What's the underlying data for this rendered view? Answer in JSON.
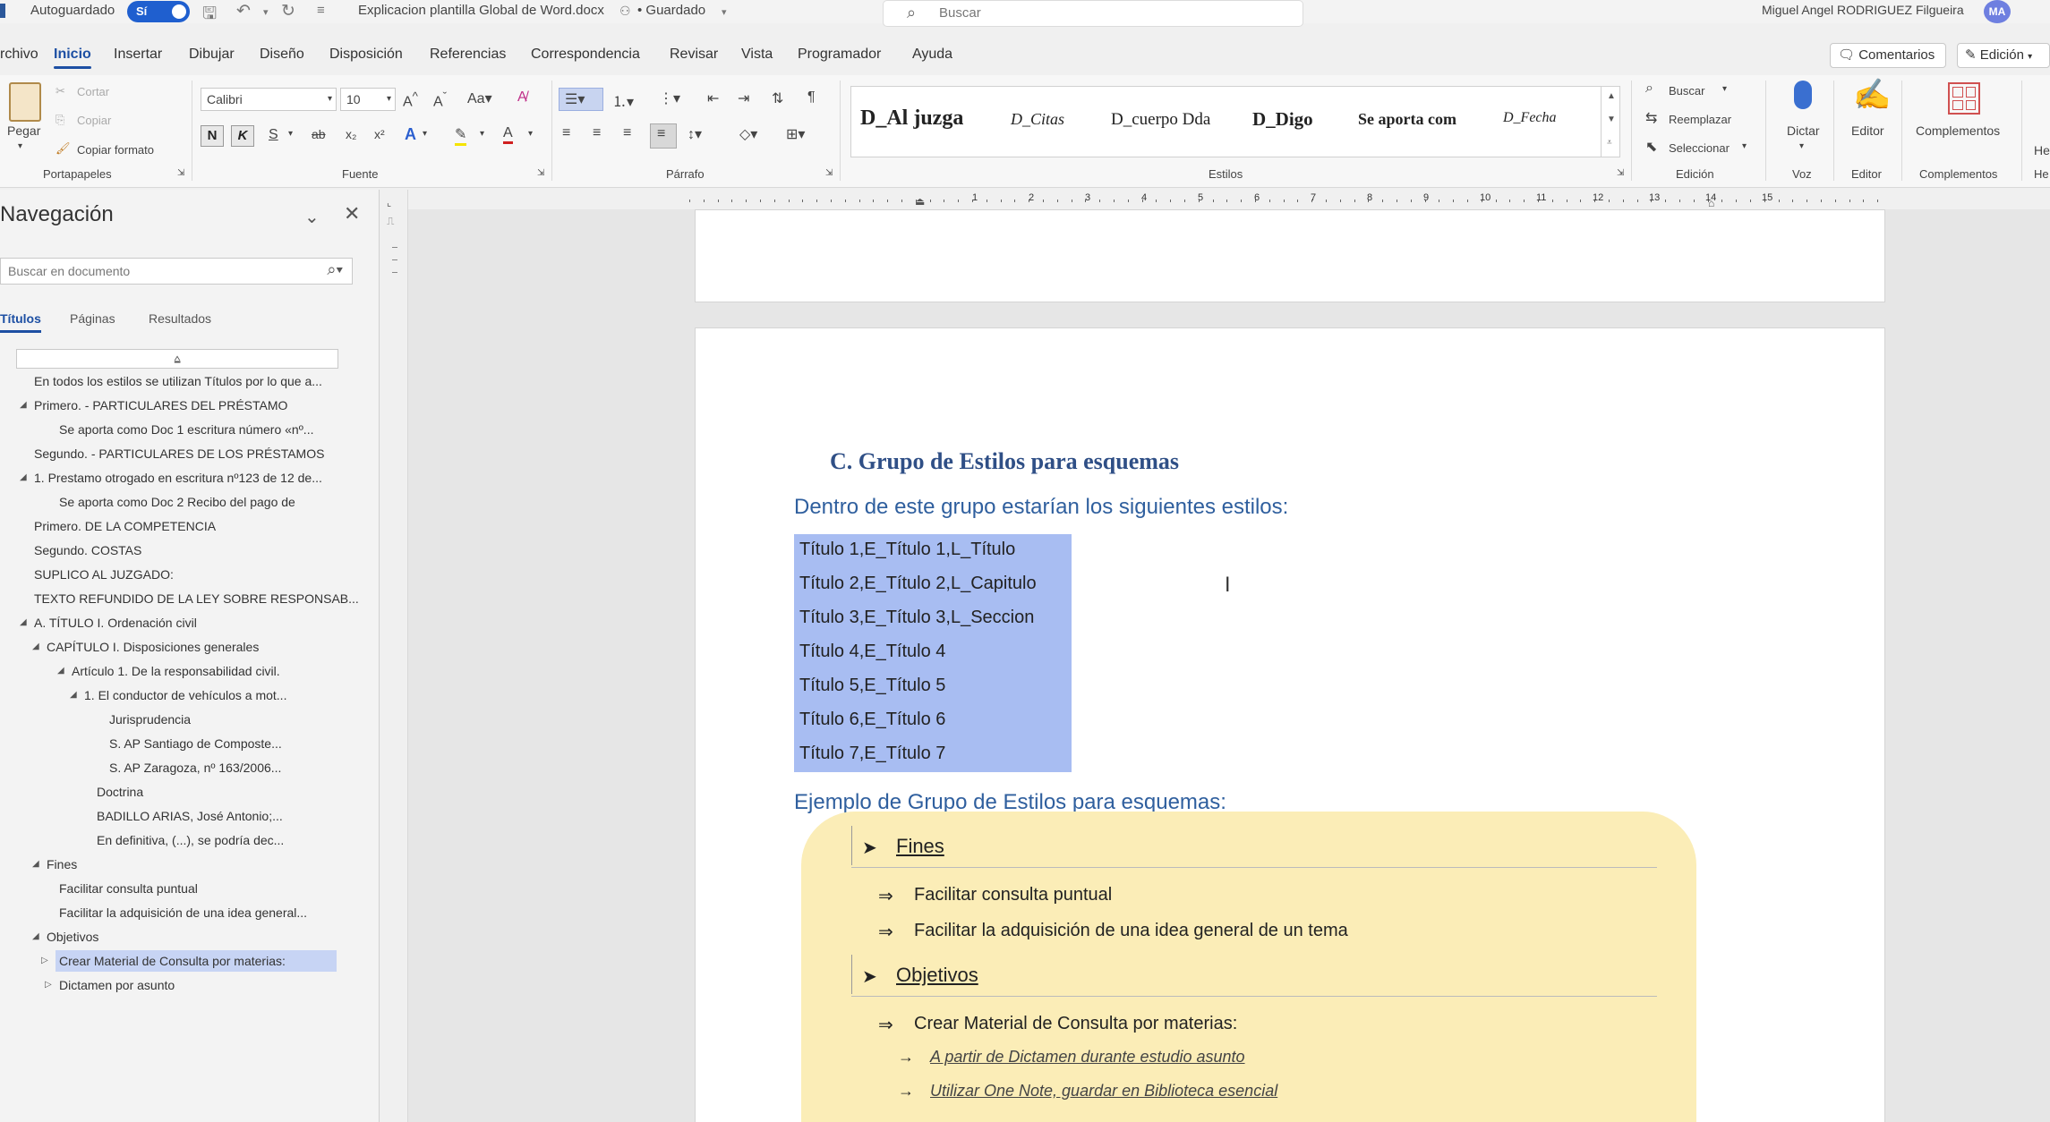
{
  "titlebar": {
    "autosave_label": "Autoguardado",
    "autosave_toggle": "Sí",
    "filename": "Explicacion plantilla Global de Word.docx",
    "saved_status": "• Guardado",
    "search_placeholder": "Buscar",
    "user_name": "Miguel Angel RODRIGUEZ Filgueira",
    "user_initials": "MA"
  },
  "menu": {
    "tabs": [
      "rchivo",
      "Inicio",
      "Insertar",
      "Dibujar",
      "Diseño",
      "Disposición",
      "Referencias",
      "Correspondencia",
      "Revisar",
      "Vista",
      "Programador",
      "Ayuda"
    ],
    "comments_label": "Comentarios",
    "edit_mode_label": "Edición"
  },
  "ribbon": {
    "clipboard": {
      "paste": "Pegar",
      "cut": "Cortar",
      "copy": "Copiar",
      "format_painter": "Copiar formato",
      "label": "Portapapeles"
    },
    "font": {
      "name": "Calibri",
      "size": "10",
      "bold": "N",
      "italic": "K",
      "underline": "S",
      "strike": "ab",
      "label": "Fuente"
    },
    "paragraph": {
      "label": "Párrafo"
    },
    "styles": {
      "label": "Estilos",
      "items": [
        "D_Al juzga",
        "D_Citas",
        "D_cuerpo Dda",
        "D_Digo",
        "Se aporta com",
        "D_Fecha"
      ]
    },
    "editing": {
      "find": "Buscar",
      "replace": "Reemplazar",
      "select": "Seleccionar",
      "label": "Edición"
    },
    "voice": {
      "dictate": "Dictar",
      "label": "Voz"
    },
    "editor": {
      "editor": "Editor",
      "label": "Editor"
    },
    "addins": {
      "addins": "Complementos",
      "label": "Complementos"
    },
    "cut_off": {
      "label_top": "He",
      "label_bottom": "He"
    }
  },
  "navigation": {
    "title": "Navegación",
    "search_placeholder": "Buscar en documento",
    "tabs": [
      "Títulos",
      "Páginas",
      "Resultados"
    ],
    "items": [
      {
        "text": "En todos los estilos se utilizan Títulos por lo que a...",
        "level": 1,
        "tri": ""
      },
      {
        "text": "Primero. -  PARTICULARES DEL PRÉSTAMO",
        "level": 1,
        "tri": "◢"
      },
      {
        "text": "Se aporta como Doc 1 escritura número «nº...",
        "level": 3,
        "tri": ""
      },
      {
        "text": "Segundo. -  PARTICULARES DE LOS PRÉSTAMOS",
        "level": 1,
        "tri": ""
      },
      {
        "text": "1. Prestamo otrogado en escritura nº123 de 12 de...",
        "level": 1,
        "tri": "◢"
      },
      {
        "text": "Se aporta como Doc 2 Recibo del pago de",
        "level": 3,
        "tri": ""
      },
      {
        "text": "Primero. DE LA COMPETENCIA",
        "level": 1,
        "tri": ""
      },
      {
        "text": "Segundo. COSTAS",
        "level": 1,
        "tri": ""
      },
      {
        "text": "SUPLICO AL JUZGADO:",
        "level": 1,
        "tri": ""
      },
      {
        "text": "TEXTO REFUNDIDO DE LA LEY SOBRE RESPONSAB...",
        "level": 1,
        "tri": ""
      },
      {
        "text": "A. TÍTULO I. Ordenación civil",
        "level": 1,
        "tri": "◢"
      },
      {
        "text": "CAPÍTULO I. Disposiciones generales",
        "level": 2,
        "tri": "◢"
      },
      {
        "text": "Artículo 1. De la responsabilidad civil.",
        "level": 4,
        "tri": "◢"
      },
      {
        "text": "1. El conductor de vehículos a mot...",
        "level": 5,
        "tri": "◢"
      },
      {
        "text": "Jurisprudencia",
        "level": 7,
        "tri": ""
      },
      {
        "text": "S. AP Santiago de Composte...",
        "level": 7,
        "tri": ""
      },
      {
        "text": "S. AP Zaragoza, nº 163/2006...",
        "level": 7,
        "tri": ""
      },
      {
        "text": "Doctrina",
        "level": 6,
        "tri": ""
      },
      {
        "text": "BADILLO ARIAS, José Antonio;...",
        "level": 6,
        "tri": ""
      },
      {
        "text": "En definitiva, (...), se podría dec...",
        "level": 6,
        "tri": ""
      },
      {
        "text": "Fines",
        "level": 2,
        "tri": "◢"
      },
      {
        "text": "Facilitar consulta puntual",
        "level": 3,
        "tri": ""
      },
      {
        "text": "Facilitar la adquisición de una idea general...",
        "level": 3,
        "tri": ""
      },
      {
        "text": "Objetivos",
        "level": 2,
        "tri": "◢"
      },
      {
        "text": "Crear Material de Consulta por materias:",
        "level": 3,
        "tri": "▷",
        "selected": true
      },
      {
        "text": "Dictamen por asunto",
        "level": 3,
        "tri": "▷"
      }
    ]
  },
  "document": {
    "heading": "C. Grupo de Estilos para esquemas",
    "intro": "Dentro de este grupo estarían los siguientes estilos:",
    "style_list": [
      "Título 1,E_Título 1,L_Título",
      "Título 2,E_Título 2,L_Capitulo",
      "Título 3,E_Título 3,L_Seccion",
      "Título 4,E_Título 4",
      "Título 5,E_Título 5",
      "Título 6,E_Título 6",
      "Título 7,E_Título 7"
    ],
    "example_heading": "Ejemplo de Grupo de Estilos para esquemas:",
    "example": {
      "group1": "Fines",
      "group1_items": [
        "Facilitar consulta puntual",
        "Facilitar la adquisición de una idea general de un tema"
      ],
      "group2": "Objetivos",
      "group2_item": "Crear Material de Consulta por materias:",
      "group2_subitems": [
        "A partir de Dictamen durante estudio asunto",
        "Utilizar One Note, guardar en Biblioteca esencial"
      ]
    }
  },
  "ruler_numbers": [
    "1",
    "2",
    "3",
    "4",
    "5",
    "6",
    "7",
    "8",
    "9",
    "10",
    "11",
    "12",
    "13",
    "14",
    "15"
  ]
}
